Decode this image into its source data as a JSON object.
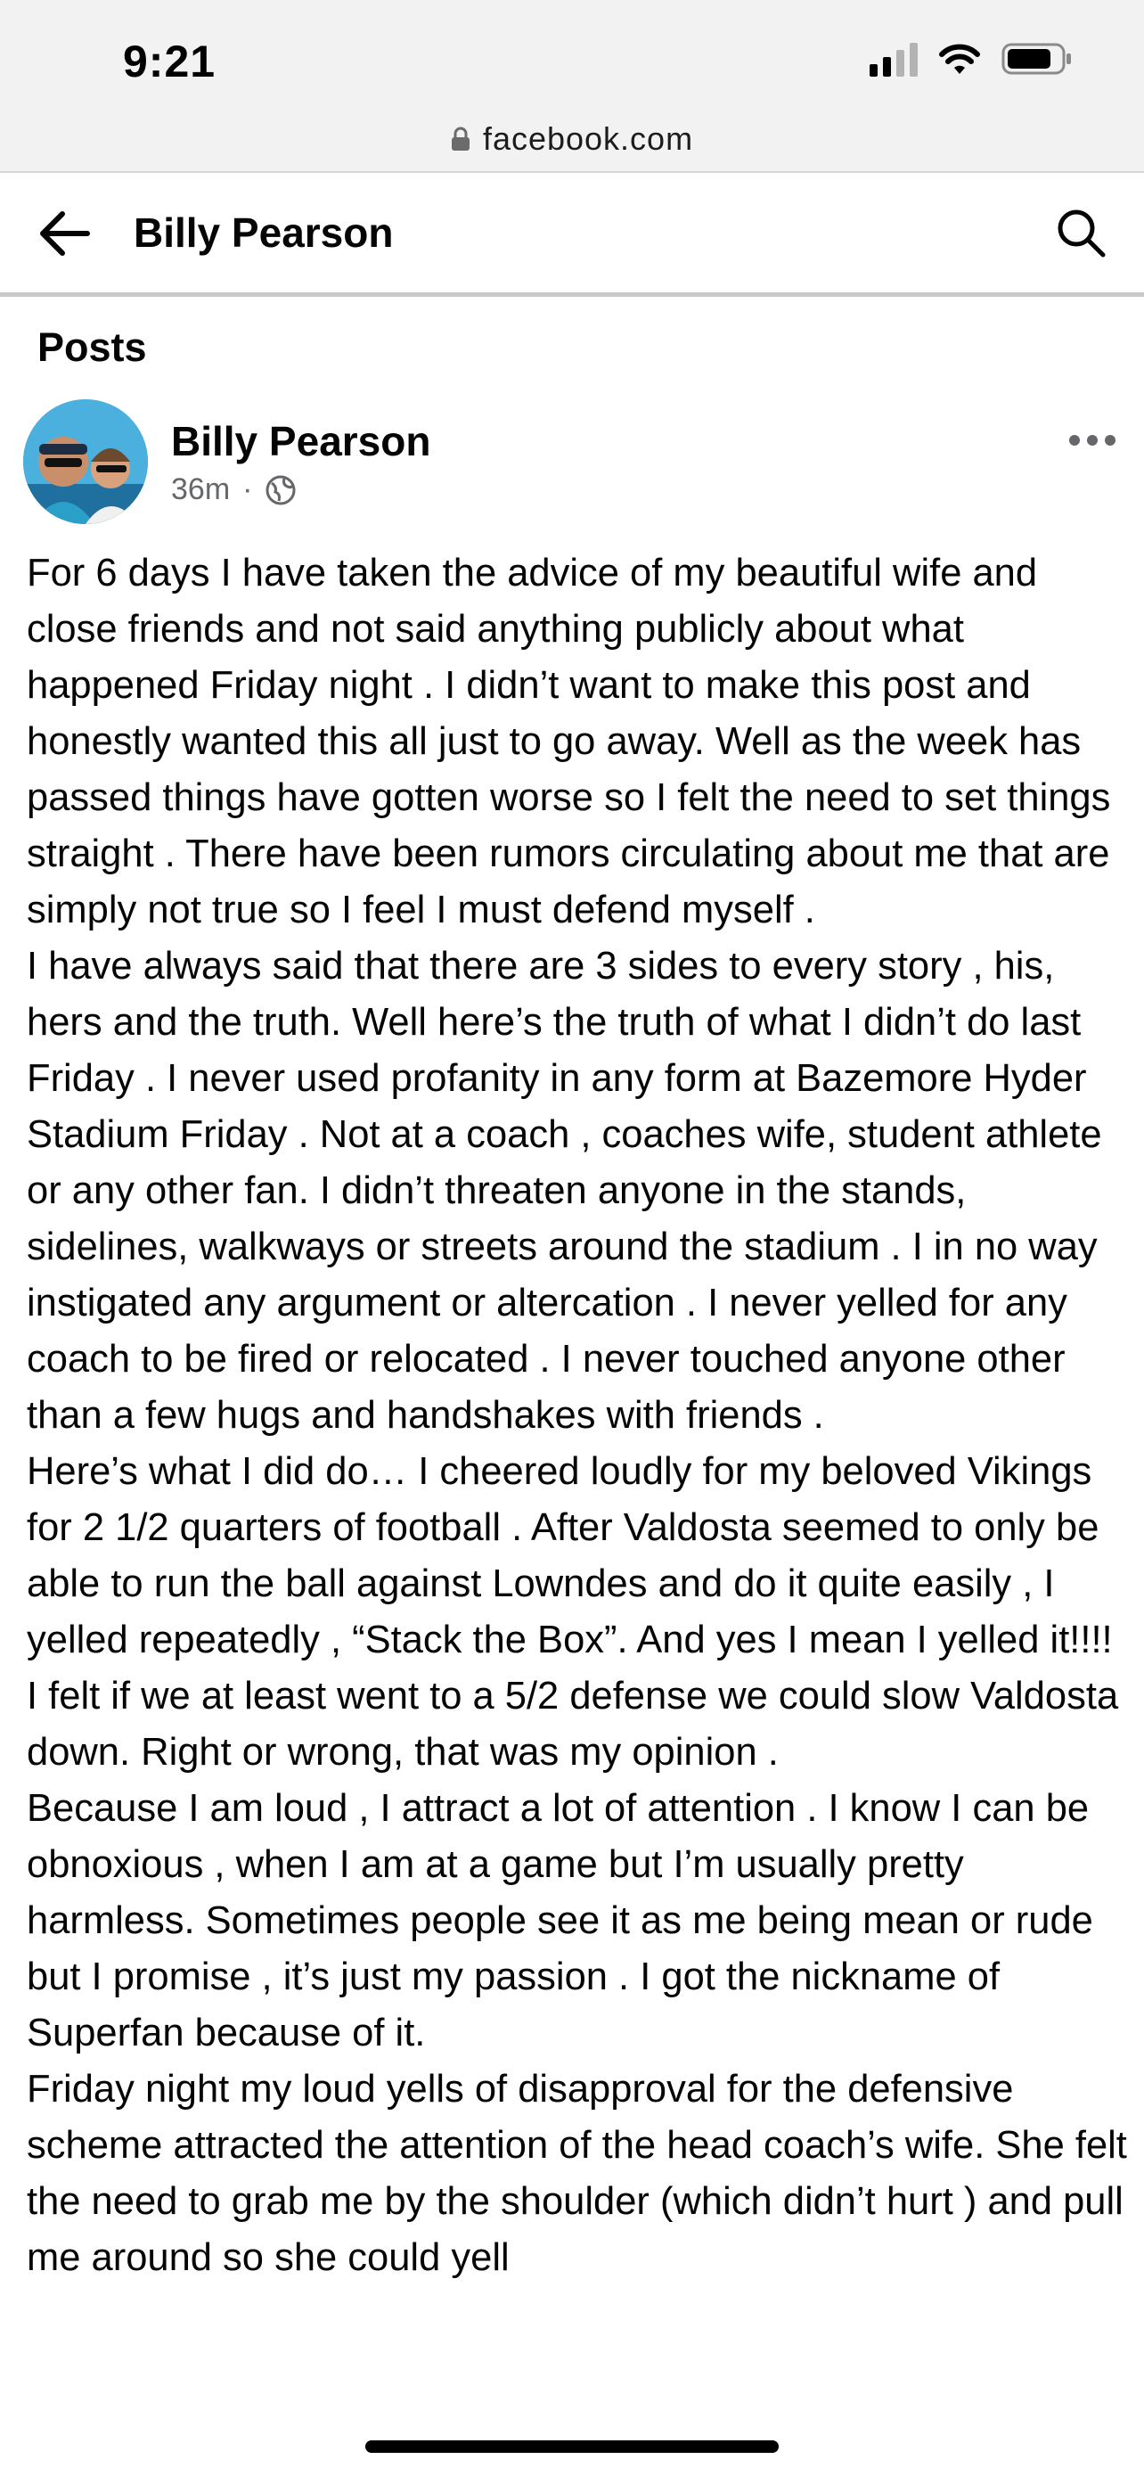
{
  "status_bar": {
    "time": "9:21",
    "icons": [
      "cellular-signal-icon",
      "wifi-icon",
      "battery-icon"
    ]
  },
  "browser": {
    "url": "facebook.com",
    "lock_icon": "lock-icon"
  },
  "header": {
    "back_icon": "arrow-left-icon",
    "title": "Billy Pearson",
    "search_icon": "search-icon"
  },
  "section": {
    "title": "Posts"
  },
  "post": {
    "author": "Billy Pearson",
    "time": "36m",
    "separator": "·",
    "audience_icon": "globe-icon",
    "more_icon": "more-horizontal-icon",
    "body": "For 6 days I have taken the advice of my beautiful wife and close friends and not said anything publicly about what happened Friday night . I didn’t want to make this post and honestly wanted this all just to go away. Well as the week has passed things have gotten worse so I felt the need to set things straight . There have been rumors circulating about me that are simply not true so I feel I must defend myself .\n I have always said that there are 3 sides to every story , his, hers and the truth. Well here’s the truth of what I didn’t do last Friday . I never used profanity in any form at Bazemore Hyder Stadium Friday . Not at a coach , coaches wife, student athlete or any other fan. I didn’t threaten anyone in the stands, sidelines, walkways or streets around the stadium . I in no way instigated any argument or altercation . I never yelled for any coach to be fired or relocated . I never touched anyone other than a few hugs and handshakes with friends .\n  Here’s what I did do… I cheered loudly for my beloved Vikings for 2 1/2 quarters of football . After Valdosta seemed to only be able to run the ball against Lowndes and do it quite easily , I yelled repeatedly , “Stack the Box”. And yes I mean I yelled it!!!! I felt if we at least went to a 5/2 defense we could slow Valdosta down. Right or wrong, that was my opinion .\n  Because I am loud , I attract a lot of attention . I know I can be obnoxious , when I am at a game but I’m usually pretty harmless. Sometimes people see it as me being mean or rude but I promise , it’s just my passion . I got the nickname of Superfan because of it.\n Friday night my loud yells of disapproval for the defensive scheme attracted the attention of the head coach’s wife. She felt the need to grab me by the shoulder (which didn’t hurt ) and pull me around so she could yell"
  },
  "colors": {
    "chrome_background": "#f2f2f2",
    "text_primary": "#050505",
    "text_secondary": "#65676b",
    "divider": "#c8c8c8"
  }
}
